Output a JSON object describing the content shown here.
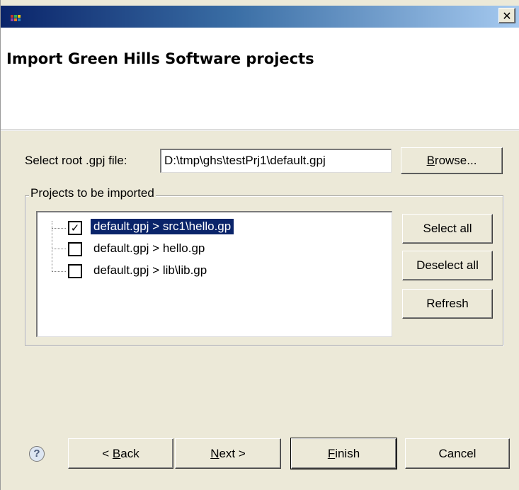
{
  "window": {
    "close_label": "✕"
  },
  "header": {
    "title": "Import Green Hills Software projects"
  },
  "root_file": {
    "label": "Select root .gpj file:",
    "value": "D:\\tmp\\ghs\\testPrj1\\default.gpj",
    "browse_prefix": "",
    "browse_mnemonic": "B",
    "browse_rest": "rowse..."
  },
  "projects": {
    "group_label": "Projects to be imported",
    "items": [
      {
        "label": "default.gpj > src1\\hello.gp",
        "checked": true,
        "selected": true
      },
      {
        "label": "default.gpj > hello.gp",
        "checked": false,
        "selected": false
      },
      {
        "label": "default.gpj > lib\\lib.gp",
        "checked": false,
        "selected": false
      }
    ],
    "select_all": "Select all",
    "deselect_all": "Deselect all",
    "refresh": "Refresh"
  },
  "footer": {
    "help": "?",
    "back_prefix": "< ",
    "back_mnemonic": "B",
    "back_rest": "ack",
    "next_mnemonic": "N",
    "next_rest": "ext >",
    "finish_mnemonic": "F",
    "finish_rest": "inish",
    "cancel": "Cancel"
  },
  "colors": {
    "selection": "#0a246a",
    "dialog_bg": "#ece9d8"
  }
}
